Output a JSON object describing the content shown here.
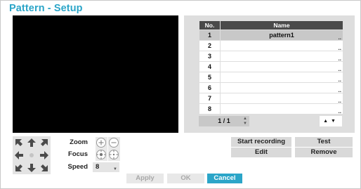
{
  "window": {
    "title": "Pattern - Setup"
  },
  "pattern_table": {
    "headers": {
      "no": "No.",
      "name": "Name"
    },
    "rows": [
      {
        "no": "1",
        "name": "pattern1",
        "selected": true
      },
      {
        "no": "2",
        "name": ""
      },
      {
        "no": "3",
        "name": ""
      },
      {
        "no": "4",
        "name": ""
      },
      {
        "no": "5",
        "name": ""
      },
      {
        "no": "6",
        "name": ""
      },
      {
        "no": "7",
        "name": ""
      },
      {
        "no": "8",
        "name": ""
      }
    ],
    "edit_glyph": "..",
    "page": "1 / 1"
  },
  "ptz": {
    "icons": [
      "arrow-up-left-icon",
      "arrow-up-icon",
      "arrow-up-right-icon",
      "arrow-left-icon",
      "center-dot-icon",
      "arrow-right-icon",
      "arrow-down-left-icon",
      "arrow-down-icon",
      "arrow-down-right-icon"
    ]
  },
  "controls": {
    "zoom_label": "Zoom",
    "focus_label": "Focus",
    "speed_label": "Speed",
    "speed_value": "8"
  },
  "buttons": {
    "start_recording": "Start recording",
    "test": "Test",
    "edit": "Edit",
    "remove": "Remove",
    "apply": "Apply",
    "ok": "OK",
    "cancel": "Cancel"
  },
  "colors": {
    "accent": "#2ba5c8",
    "video": "#000000",
    "panel": "#dedede",
    "header": "#4a4a4a"
  }
}
